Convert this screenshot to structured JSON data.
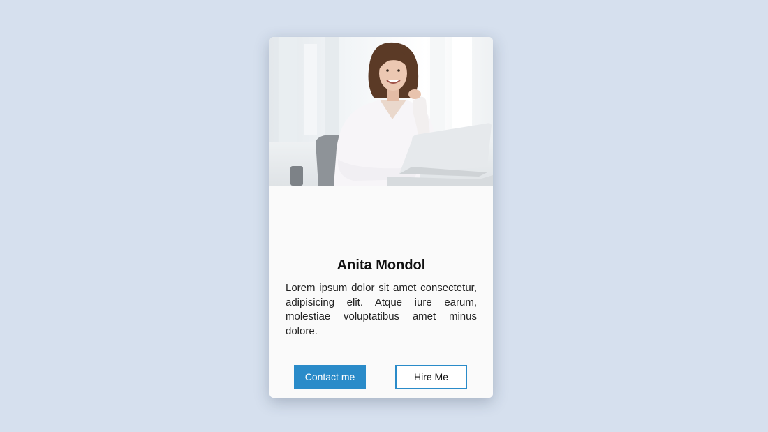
{
  "profile_card": {
    "photo_alt": "Anita Mondol",
    "name": "Anita Mondol",
    "bio": "Lorem ipsum dolor sit amet consectetur, adipisicing elit. Atque iure earum, molestiae voluptatibus amet minus dolore.",
    "contact_label": "Contact me",
    "hire_label": "Hire Me"
  },
  "colors": {
    "background": "#d6e0ee",
    "accent": "#2a8bc9",
    "card": "#ffffff"
  }
}
